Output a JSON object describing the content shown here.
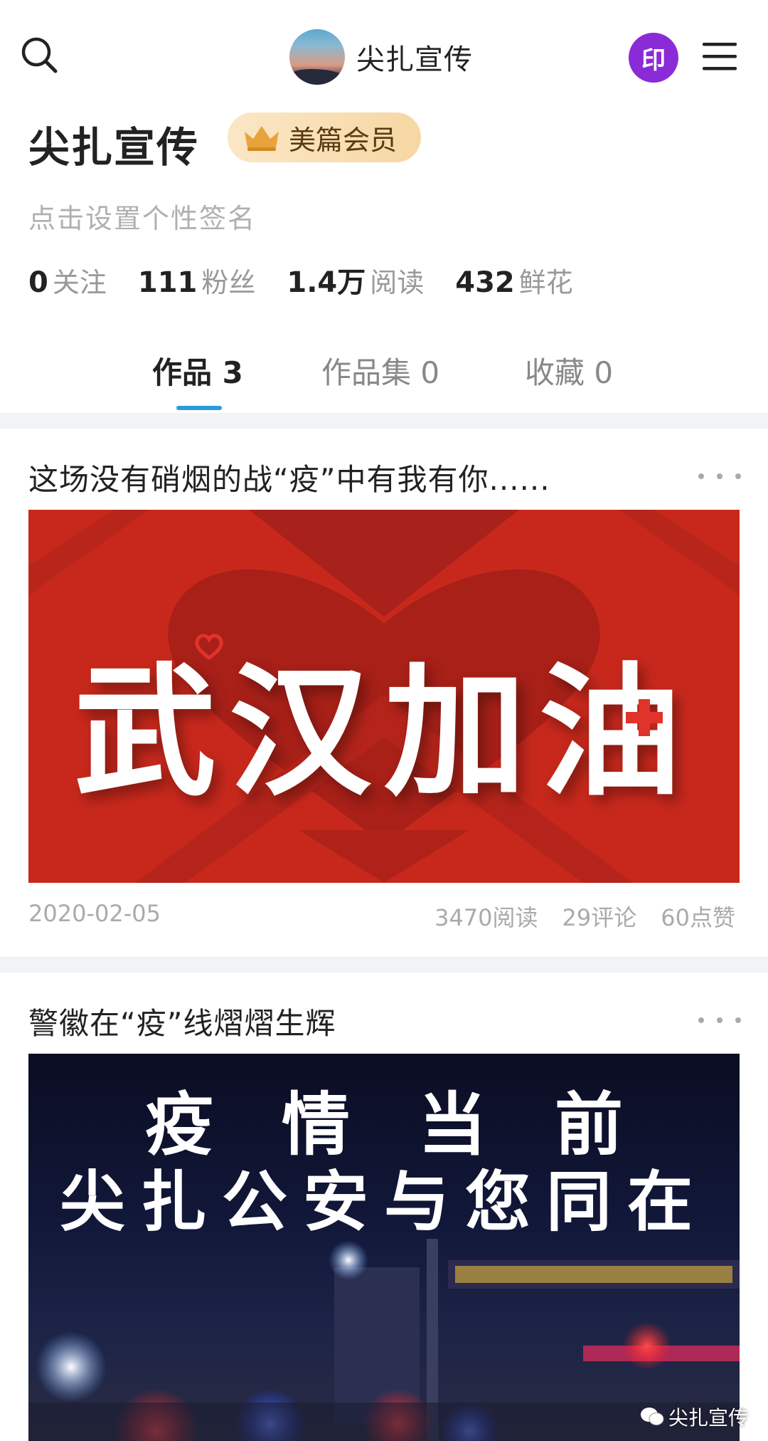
{
  "header": {
    "account_name": "尖扎宣传",
    "print_badge": "印"
  },
  "profile": {
    "name": "尖扎宣传",
    "vip_label": "美篇会员",
    "signature_placeholder": "点击设置个性签名",
    "stats": [
      {
        "value": "0",
        "label": "关注"
      },
      {
        "value": "111",
        "label": "粉丝"
      },
      {
        "value": "1.4万",
        "label": "阅读"
      },
      {
        "value": "432",
        "label": "鲜花"
      }
    ]
  },
  "tabs": [
    {
      "label": "作品 3",
      "active": true
    },
    {
      "label": "作品集 0",
      "active": false
    },
    {
      "label": "收藏 0",
      "active": false
    }
  ],
  "posts": [
    {
      "title": "这场没有硝烟的战“疫”中有我有你......",
      "cover_text": "武汉加油",
      "date": "2020-02-05",
      "reads": "3470阅读",
      "comments": "29评论",
      "likes": "60点赞"
    },
    {
      "title": "警徽在“疫”线熠熠生辉",
      "cover_line_1": "疫情当前",
      "cover_line_2": "尖扎公安与您同在"
    }
  ],
  "watermark": "尖扎宣传",
  "colors": {
    "accent": "#2a9bd9",
    "print_badge": "#8b2bd8",
    "vip_badge": "#f6d7a3",
    "cover_red": "#c8281c"
  },
  "icons": {
    "search": "search-icon",
    "menu": "hamburger-menu-icon",
    "crown": "crown-icon",
    "more": "more-dots-icon",
    "wechat": "wechat-icon"
  }
}
